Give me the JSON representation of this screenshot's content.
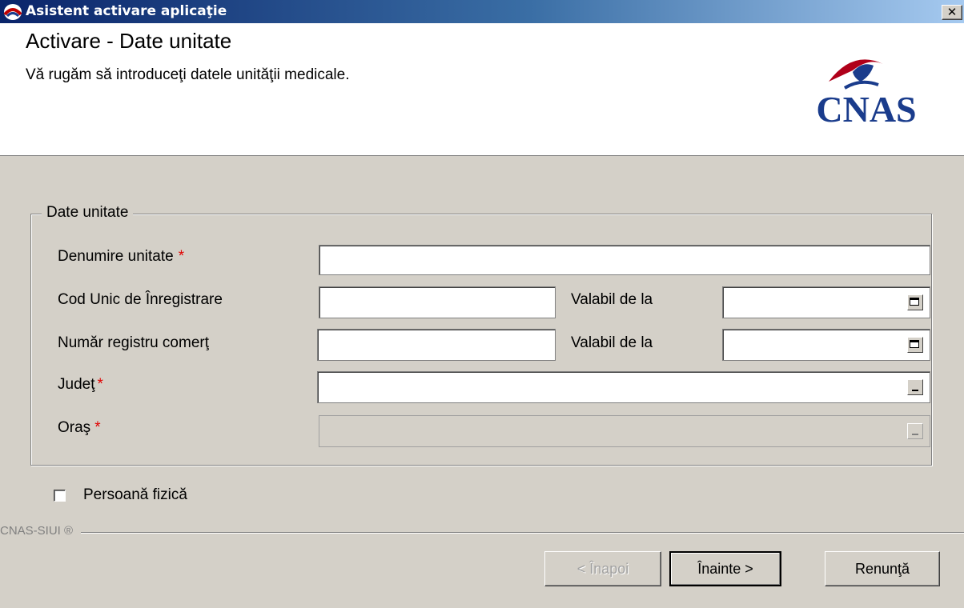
{
  "window": {
    "title": "Asistent activare aplicaţie",
    "close_glyph": "✕"
  },
  "header": {
    "title": "Activare - Date unitate",
    "subtitle": "Vă rugăm să introduceţi datele unităţii medicale.",
    "logo_text": "CNAS"
  },
  "form": {
    "group_label": "Date unitate",
    "required_marker": "*",
    "fields": {
      "denumire": {
        "label": "Denumire unitate",
        "value": ""
      },
      "cui": {
        "label": "Cod Unic de Înregistrare",
        "value": ""
      },
      "cui_valid": {
        "label": "Valabil de la",
        "value": ""
      },
      "nr_reg": {
        "label": "Număr registru comerţ",
        "value": ""
      },
      "nr_reg_valid": {
        "label": "Valabil de la",
        "value": ""
      },
      "judet": {
        "label": "Judeţ",
        "value": ""
      },
      "oras": {
        "label": "Oraş",
        "value": ""
      }
    },
    "persoana_fizica": {
      "label": "Persoană fizică",
      "checked": false
    }
  },
  "footer": {
    "brand": "CNAS-SIUI ®",
    "back_label": "< Înapoi",
    "next_label": "Înainte >",
    "cancel_label": "Renunţă"
  },
  "icons": [
    "app-icon",
    "close-icon",
    "cnas-logo",
    "calendar-icon",
    "ellipsis-icon"
  ],
  "colors": {
    "title_bar": "#0a246a",
    "required": "#e00000",
    "face": "#d4d0c8"
  }
}
